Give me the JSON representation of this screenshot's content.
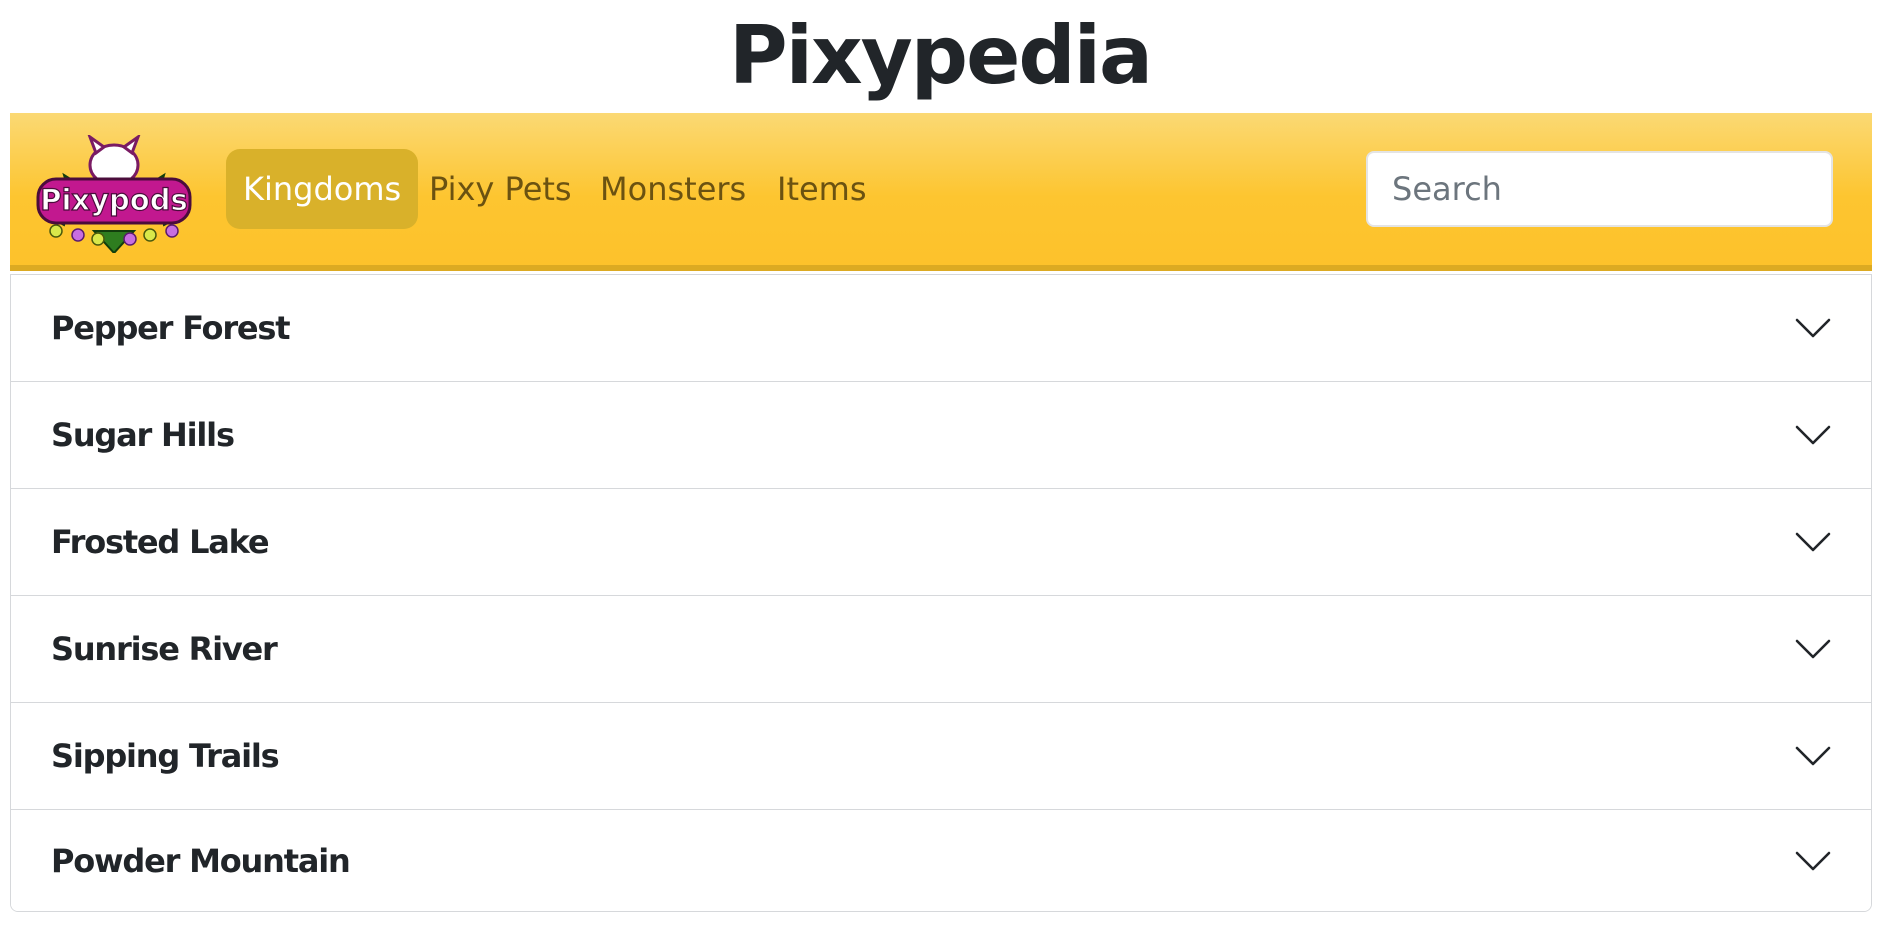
{
  "site": {
    "title": "Pixypedia"
  },
  "logo": {
    "text": "Pixypods",
    "icon": "pixypods-logo"
  },
  "nav": {
    "items": [
      {
        "label": "Kingdoms",
        "active": true
      },
      {
        "label": "Pixy Pets",
        "active": false
      },
      {
        "label": "Monsters",
        "active": false
      },
      {
        "label": "Items",
        "active": false
      }
    ]
  },
  "search": {
    "placeholder": "Search",
    "value": ""
  },
  "accordion": {
    "items": [
      {
        "label": "Pepper Forest",
        "icon": "chevron-down-icon"
      },
      {
        "label": "Sugar Hills",
        "icon": "chevron-down-icon"
      },
      {
        "label": "Frosted Lake",
        "icon": "chevron-down-icon"
      },
      {
        "label": "Sunrise River",
        "icon": "chevron-down-icon"
      },
      {
        "label": "Sipping Trails",
        "icon": "chevron-down-icon"
      },
      {
        "label": "Powder Mountain",
        "icon": "chevron-down-icon"
      }
    ]
  },
  "colors": {
    "navbar_top": "#fbd974",
    "navbar_bottom": "#fdc22b",
    "nav_active_bg": "#d9b12a",
    "nav_text": "#6b5211",
    "title_text": "#212529"
  }
}
